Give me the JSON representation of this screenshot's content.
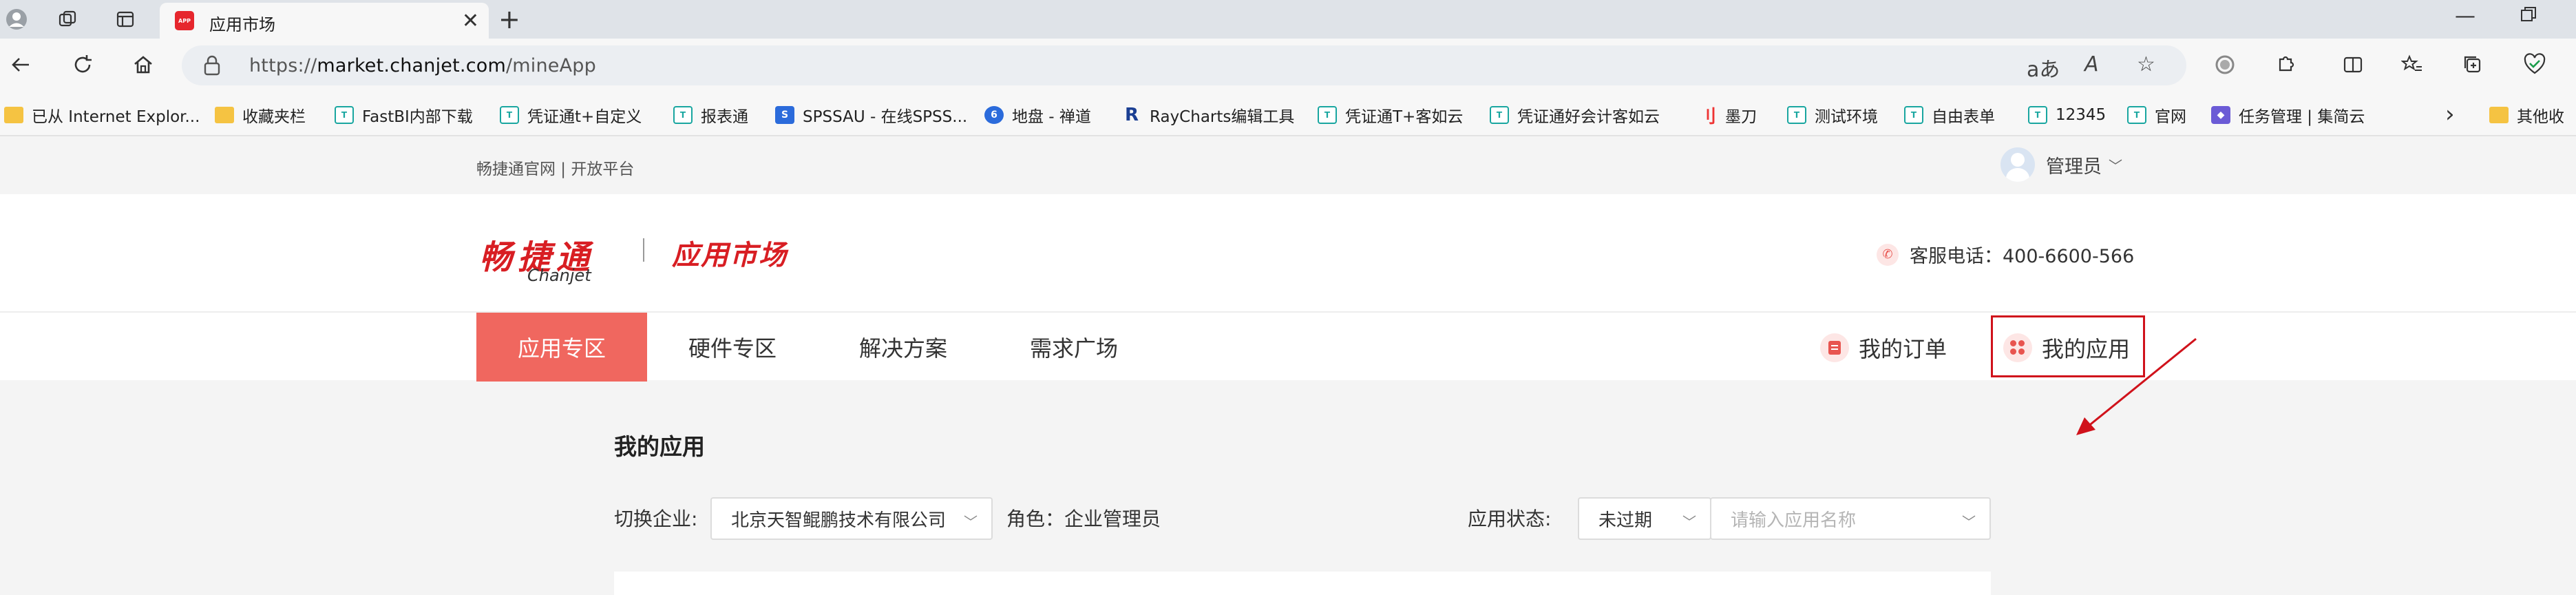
{
  "browser": {
    "tab_title": "应用市场",
    "tab_favicon_text": "APP",
    "url_prefix": "https://",
    "url_domain": "market.chanjet.com",
    "url_path": "/mineApp",
    "read_aloud_label": "aあ",
    "text_size_label": "A",
    "bookmarks": [
      {
        "label": "已从 Internet Explor...",
        "icon": "folder-icon"
      },
      {
        "label": "收藏夹栏",
        "icon": "folder-icon"
      },
      {
        "label": "FastBI内部下载",
        "icon": "t-icon"
      },
      {
        "label": "凭证通t+自定义",
        "icon": "t-icon"
      },
      {
        "label": "报表通",
        "icon": "t-icon"
      },
      {
        "label": "SPSSAU - 在线SPSS...",
        "icon": "s-icon"
      },
      {
        "label": "地盘 - 禅道",
        "icon": "chandao-icon"
      },
      {
        "label": "RayCharts编辑工具",
        "icon": "raycharts-icon"
      },
      {
        "label": "凭证通T+客如云",
        "icon": "t-icon"
      },
      {
        "label": "凭证通好会计客如云",
        "icon": "t-icon"
      },
      {
        "label": "墨刀",
        "icon": "modao-icon"
      },
      {
        "label": "测试环境",
        "icon": "t-icon"
      },
      {
        "label": "自由表单",
        "icon": "t-icon"
      },
      {
        "label": "12345",
        "icon": "t-icon"
      },
      {
        "label": "官网",
        "icon": "t-icon"
      },
      {
        "label": "任务管理 | 集简云",
        "icon": "jijianyun-icon"
      },
      {
        "label": "其他收",
        "icon": "folder-icon"
      }
    ]
  },
  "site": {
    "top_links": "畅捷通官网 | 开放平台",
    "admin_label": "管理员",
    "logo_cn": "畅捷通",
    "logo_en": "Chanjet",
    "logo_market": "应用市场",
    "phone_label": "客服电话：400-6600-566",
    "nav": [
      "应用专区",
      "硬件专区",
      "解决方案",
      "需求广场"
    ],
    "my_orders": "我的订单",
    "my_apps": "我的应用"
  },
  "content": {
    "title": "我的应用",
    "switch_company_label": "切换企业:",
    "company_value": "北京天智鲲鹏技术有限公司",
    "role_label": "角色：企业管理员",
    "status_label": "应用状态:",
    "status_value": "未过期",
    "search_placeholder": "请输入应用名称"
  },
  "colors": {
    "accent": "#f0675f",
    "brand_red": "#d81e23",
    "annotation_red": "#d0121b"
  }
}
